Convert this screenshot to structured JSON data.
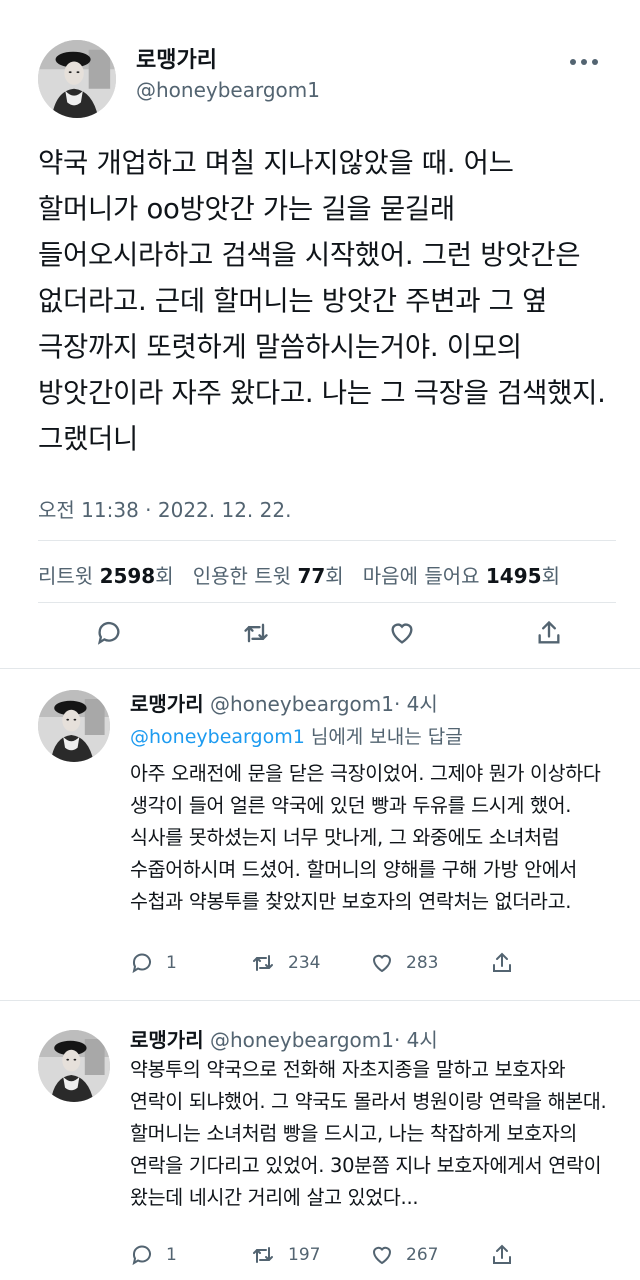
{
  "main_tweet": {
    "author_name": "로맹가리",
    "author_handle": "@honeybeargom1",
    "text": "약국 개업하고 며칠 지나지않았을 때. 어느 할머니가 oo방앗간 가는 길을 묻길래 들어오시라하고 검색을 시작했어. 그런 방앗간은 없더라고. 근데 할머니는 방앗간 주변과 그 옆 극장까지 또렷하게 말씀하시는거야. 이모의 방앗간이라 자주 왔다고. 나는 그 극장을 검색했지. 그랬더니",
    "timestamp": "오전 11:38 · 2022. 12. 22.",
    "stats": {
      "retweet_label": "리트윗",
      "retweet_count": "2598",
      "retweet_unit": "회",
      "quote_label": "인용한 트윗",
      "quote_count": "77",
      "quote_unit": "회",
      "like_label": "마음에 들어요",
      "like_count": "1495",
      "like_unit": "회"
    }
  },
  "replies": [
    {
      "author_name": "로맹가리",
      "author_handle": "@honeybeargom1",
      "time": "· 4시",
      "reply_to_mention": "@honeybeargom1",
      "reply_to_suffix": " 님에게 보내는 답글",
      "text": "아주 오래전에 문을 닫은 극장이었어. 그제야 뭔가 이상하다 생각이 들어 얼른 약국에 있던 빵과 두유를 드시게 했어. 식사를 못하셨는지 너무 맛나게, 그 와중에도 소녀처럼 수줍어하시며 드셨어. 할머니의 양해를 구해 가방 안에서 수첩과 약봉투를 찾았지만 보호자의 연락처는 없더라고.",
      "reply_count": "1",
      "retweet_count": "234",
      "like_count": "283"
    },
    {
      "author_name": "로맹가리",
      "author_handle": "@honeybeargom1",
      "time": "· 4시",
      "text": "약봉투의 약국으로 전화해 자초지종을 말하고 보호자와 연락이 되냐했어. 그 약국도 몰라서 병원이랑 연락을 해본대. 할머니는 소녀처럼 빵을 드시고, 나는 착잡하게 보호자의 연락을 기다리고 있었어. 30분쯤 지나 보호자에게서 연락이 왔는데 네시간 거리에 살고 있었다...",
      "reply_count": "1",
      "retweet_count": "197",
      "like_count": "267"
    }
  ],
  "colors": {
    "text": "#0f1419",
    "secondary": "#536471",
    "link": "#1d9bf0",
    "divider": "#e3e7ea"
  },
  "icons": [
    "more-icon",
    "reply-icon",
    "retweet-icon",
    "like-icon",
    "share-icon"
  ]
}
